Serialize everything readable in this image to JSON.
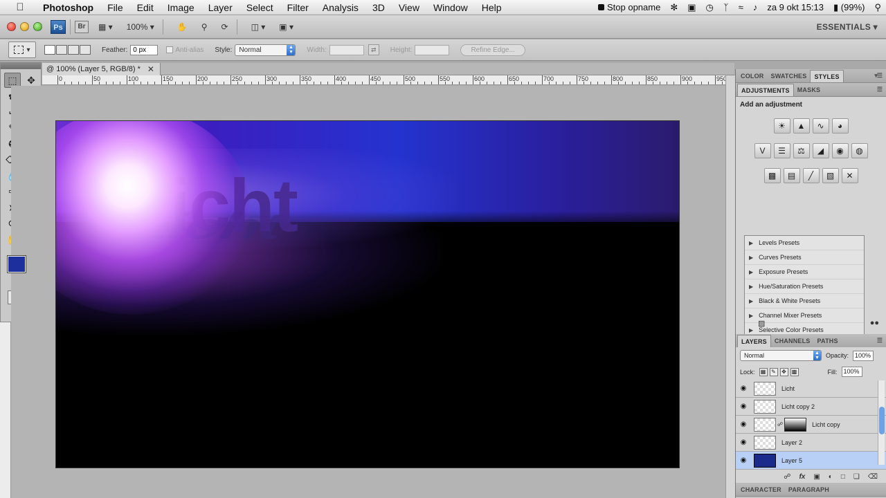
{
  "menubar": {
    "app": "Photoshop",
    "items": [
      "File",
      "Edit",
      "Image",
      "Layer",
      "Select",
      "Filter",
      "Analysis",
      "3D",
      "View",
      "Window",
      "Help"
    ],
    "stop_recording": "Stop opname",
    "clock": "za 9 okt  15:13",
    "battery": "(99%)"
  },
  "appbar": {
    "ps_label": "Ps",
    "br_label": "Br",
    "zoom": "100%",
    "workspace": "ESSENTIALS"
  },
  "options": {
    "feather_label": "Feather:",
    "feather_value": "0 px",
    "antialias_label": "Anti-alias",
    "style_label": "Style:",
    "style_value": "Normal",
    "width_label": "Width:",
    "height_label": "Height:",
    "refine_label": "Refine Edge..."
  },
  "document": {
    "tab_title": "@ 100% (Layer 5, RGB/8) *",
    "ruler_labels": [
      "0",
      "50",
      "100",
      "150",
      "200",
      "250",
      "300",
      "350",
      "400",
      "450",
      "500",
      "550",
      "600",
      "650",
      "700",
      "750",
      "800",
      "850",
      "900",
      "950"
    ],
    "artwork_text": "Licht"
  },
  "panels": {
    "color_tabs": [
      "COLOR",
      "SWATCHES",
      "STYLES"
    ],
    "adj_tabs": [
      "ADJUSTMENTS",
      "MASKS"
    ],
    "adj_title": "Add an adjustment",
    "presets": [
      "Levels Presets",
      "Curves Presets",
      "Exposure Presets",
      "Hue/Saturation Presets",
      "Black & White Presets",
      "Channel Mixer Presets",
      "Selective Color Presets"
    ],
    "layers_tabs": [
      "LAYERS",
      "CHANNELS",
      "PATHS"
    ],
    "blend_mode": "Normal",
    "opacity_label": "Opacity:",
    "opacity_value": "100%",
    "lock_label": "Lock:",
    "fill_label": "Fill:",
    "fill_value": "100%",
    "layers": [
      {
        "name": "Licht",
        "selected": false,
        "mask": false
      },
      {
        "name": "Licht copy 2",
        "selected": false,
        "mask": false
      },
      {
        "name": "Licht copy",
        "selected": false,
        "mask": true
      },
      {
        "name": "Layer 2",
        "selected": false,
        "mask": false
      },
      {
        "name": "Layer 5",
        "selected": true,
        "mask": false
      }
    ],
    "char_tabs": [
      "CHARACTER",
      "PARAGRAPH"
    ]
  },
  "colors": {
    "foreground": "#1d2f9c",
    "background": "#000000",
    "selection": "#b8d0f5"
  }
}
